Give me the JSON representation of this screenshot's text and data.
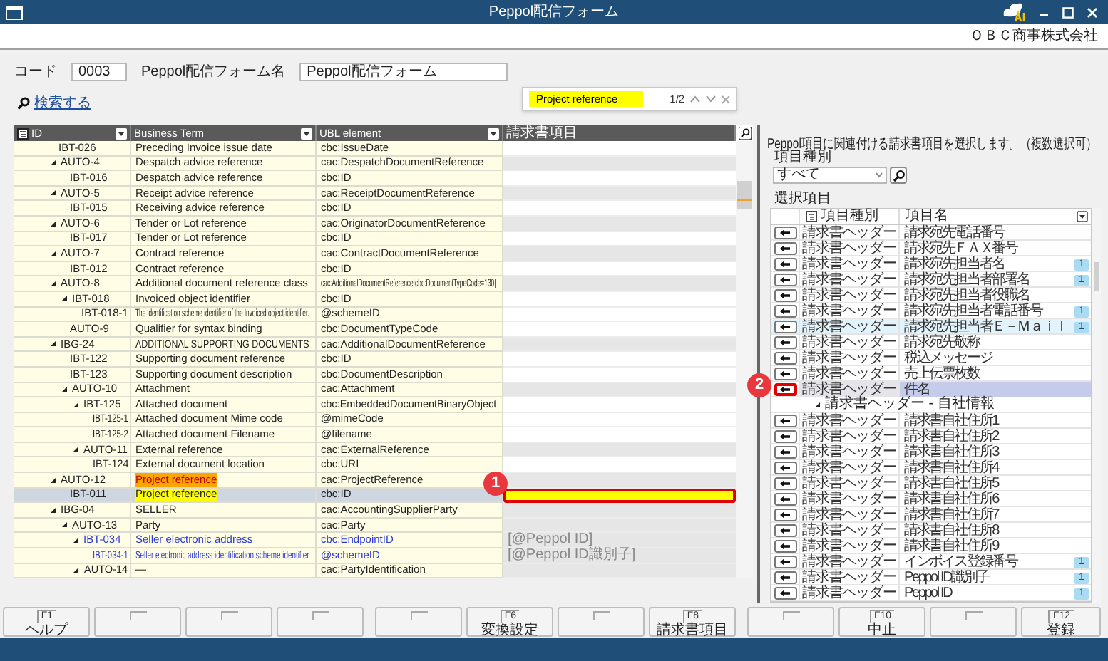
{
  "window": {
    "title": "Peppol配信フォーム",
    "company": "ＯＢＣ商事株式会社"
  },
  "header_fields": [
    {
      "label": "コード",
      "value": "0003"
    },
    {
      "label": "Peppol配信フォーム名",
      "value": "Peppol配信フォーム"
    }
  ],
  "search_link": "検索する",
  "find_bar": {
    "query": "Project reference",
    "count": "1/2"
  },
  "mapping_table": {
    "columns": [
      "ID",
      "Business Term",
      "UBL element",
      "請求書項目"
    ],
    "rows": [
      {
        "id": "IBT-026",
        "term": "Preceding Invoice issue date",
        "ubl": "cbc:IssueDate",
        "mappable": true,
        "fixed": false,
        "matched": false,
        "selected": false,
        "outlined": false
      },
      {
        "id": "AUTO-4",
        "term": "Despatch advice reference",
        "ubl": "cac:DespatchDocumentReference",
        "mappable": false,
        "fixed": false,
        "matched": false,
        "selected": false,
        "outlined": false,
        "expanded": true,
        "children": [
          {
            "id": "IBT-016",
            "term": "Despatch advice reference",
            "ubl": "cbc:ID",
            "mappable": true,
            "fixed": false,
            "matched": false,
            "selected": false,
            "outlined": false
          }
        ]
      },
      {
        "id": "AUTO-5",
        "term": "Receipt advice reference",
        "ubl": "cac:ReceiptDocumentReference",
        "mappable": false,
        "fixed": false,
        "matched": false,
        "selected": false,
        "outlined": false,
        "expanded": true,
        "children": [
          {
            "id": "IBT-015",
            "term": "Receiving advice reference",
            "ubl": "cbc:ID",
            "mappable": true,
            "fixed": false,
            "matched": false,
            "selected": false,
            "outlined": false
          }
        ]
      },
      {
        "id": "AUTO-6",
        "term": "Tender or Lot reference",
        "ubl": "cac:OriginatorDocumentReference",
        "mappable": false,
        "fixed": false,
        "matched": false,
        "selected": false,
        "outlined": false,
        "expanded": true,
        "children": [
          {
            "id": "IBT-017",
            "term": "Tender or Lot reference",
            "ubl": "cbc:ID",
            "mappable": true,
            "fixed": false,
            "matched": false,
            "selected": false,
            "outlined": false
          }
        ]
      },
      {
        "id": "AUTO-7",
        "term": "Contract reference",
        "ubl": "cac:ContractDocumentReference",
        "mappable": false,
        "fixed": false,
        "matched": false,
        "selected": false,
        "outlined": false,
        "expanded": true,
        "children": [
          {
            "id": "IBT-012",
            "term": "Contract reference",
            "ubl": "cbc:ID",
            "mappable": true,
            "fixed": false,
            "matched": false,
            "selected": false,
            "outlined": false
          }
        ]
      },
      {
        "id": "AUTO-8",
        "term": "Additional document reference class",
        "ubl": "cac:AdditionalDocumentReference[cbc:DocumentTypeCode=130]",
        "mappable": false,
        "fixed": false,
        "matched": false,
        "selected": false,
        "outlined": false,
        "expanded": true,
        "children": [
          {
            "id": "IBT-018",
            "term": "Invoiced object identifier",
            "ubl": "cbc:ID",
            "mappable": true,
            "fixed": false,
            "matched": false,
            "selected": false,
            "outlined": false,
            "expanded": true,
            "children": [
              {
                "id": "IBT-018-1",
                "term": "The identification scheme identifier of the Invoiced object identifier.",
                "ubl": "@schemeID",
                "mappable": true,
                "fixed": false,
                "matched": false,
                "selected": false,
                "outlined": false
              }
            ]
          },
          {
            "id": "AUTO-9",
            "term": "Qualifier for syntax binding",
            "ubl": "cbc:DocumentTypeCode",
            "mappable": true,
            "fixed": false,
            "matched": false,
            "selected": false,
            "outlined": false
          }
        ]
      },
      {
        "id": "IBG-24",
        "term": "ADDITIONAL SUPPORTING DOCUMENTS",
        "ubl": "cac:AdditionalDocumentReference",
        "mappable": false,
        "fixed": false,
        "matched": false,
        "selected": false,
        "outlined": false,
        "expanded": true,
        "children": [
          {
            "id": "IBT-122",
            "term": "Supporting document reference",
            "ubl": "cbc:ID",
            "mappable": true,
            "fixed": false,
            "matched": false,
            "selected": false,
            "outlined": false
          },
          {
            "id": "IBT-123",
            "term": "Supporting document description",
            "ubl": "cbc:DocumentDescription",
            "mappable": true,
            "fixed": false,
            "matched": false,
            "selected": false,
            "outlined": false
          },
          {
            "id": "AUTO-10",
            "term": "Attachment",
            "ubl": "cac:Attachment",
            "mappable": false,
            "fixed": false,
            "matched": false,
            "selected": false,
            "outlined": false,
            "expanded": true,
            "children": [
              {
                "id": "IBT-125",
                "term": "Attached document",
                "ubl": "cbc:EmbeddedDocumentBinaryObject",
                "mappable": true,
                "fixed": false,
                "matched": false,
                "selected": false,
                "outlined": false,
                "expanded": true,
                "children": [
                  {
                    "id": "IBT-125-1",
                    "term": "Attached document Mime code",
                    "ubl": "@mimeCode",
                    "mappable": true,
                    "fixed": false,
                    "matched": false,
                    "selected": false,
                    "outlined": false
                  },
                  {
                    "id": "IBT-125-2",
                    "term": "Attached document Filename",
                    "ubl": "@filename",
                    "mappable": true,
                    "fixed": false,
                    "matched": false,
                    "selected": false,
                    "outlined": false
                  }
                ]
              },
              {
                "id": "AUTO-11",
                "term": "External reference",
                "ubl": "cac:ExternalReference",
                "mappable": false,
                "fixed": false,
                "matched": false,
                "selected": false,
                "outlined": false,
                "expanded": true,
                "children": [
                  {
                    "id": "IBT-124",
                    "term": "External document location",
                    "ubl": "cbc:URI",
                    "mappable": true,
                    "fixed": false,
                    "matched": false,
                    "selected": false,
                    "outlined": false
                  }
                ]
              }
            ]
          }
        ]
      },
      {
        "id": "AUTO-12",
        "term": "Project reference",
        "ubl": "cac:ProjectReference",
        "mappable": false,
        "fixed": false,
        "matched": true,
        "current_match": true,
        "selected": false,
        "outlined": false,
        "expanded": true,
        "children": [
          {
            "id": "IBT-011",
            "term": "Project reference",
            "ubl": "cbc:ID",
            "mappable": true,
            "fixed": false,
            "matched": true,
            "current_match": false,
            "selected": true,
            "outlined": true
          }
        ]
      },
      {
        "id": "IBG-04",
        "term": "SELLER",
        "ubl": "cac:AccountingSupplierParty",
        "mappable": false,
        "fixed": false,
        "matched": false,
        "selected": false,
        "outlined": false,
        "expanded": true,
        "children": [
          {
            "id": "AUTO-13",
            "term": "Party",
            "ubl": "cac:Party",
            "mappable": false,
            "fixed": false,
            "matched": false,
            "selected": false,
            "outlined": false,
            "expanded": true,
            "children": [
              {
                "id": "IBT-034",
                "term": "Seller electronic address",
                "ubl": "cbc:EndpointID",
                "value": "[@Peppol ID]",
                "mappable": false,
                "fixed": true,
                "matched": false,
                "selected": false,
                "outlined": false,
                "expanded": true,
                "children": [
                  {
                    "id": "IBT-034-1",
                    "term": "Seller electronic address identification scheme identifier",
                    "ubl": "@schemeID",
                    "value": "[@Peppol ID識別子]",
                    "mappable": false,
                    "fixed": true,
                    "matched": false,
                    "selected": false,
                    "outlined": false
                  }
                ]
              },
              {
                "id": "AUTO-14",
                "term": "—",
                "ubl": "cac:PartyIdentification",
                "mappable": false,
                "fixed": false,
                "matched": false,
                "selected": false,
                "outlined": false,
                "expanded": true
              }
            ]
          }
        ]
      }
    ]
  },
  "right_panel": {
    "instruction": "Peppol項目に関連付ける請求書項目を選択します。（複数選択可）",
    "category_label": "項目種別",
    "category_value": "すべて",
    "list_label": "選択項目",
    "columns": [
      "項目種別",
      "項目名"
    ],
    "rows": [
      {
        "kind": "item",
        "type": "請求書ヘッダー",
        "name": "請求宛先電話番号",
        "selected": false,
        "hovered": false,
        "outlined": false
      },
      {
        "kind": "item",
        "type": "請求書ヘッダー",
        "name": "請求宛先ＦＡＸ番号",
        "selected": false,
        "hovered": false,
        "outlined": false
      },
      {
        "kind": "item",
        "type": "請求書ヘッダー",
        "name": "請求宛先担当者名",
        "badge": "1",
        "selected": false,
        "hovered": false,
        "outlined": false
      },
      {
        "kind": "item",
        "type": "請求書ヘッダー",
        "name": "請求宛先担当者部署名",
        "badge": "1",
        "selected": false,
        "hovered": false,
        "outlined": false
      },
      {
        "kind": "item",
        "type": "請求書ヘッダー",
        "name": "請求宛先担当者役職名",
        "selected": false,
        "hovered": false,
        "outlined": false
      },
      {
        "kind": "item",
        "type": "請求書ヘッダー",
        "name": "請求宛先担当者電話番号",
        "badge": "1",
        "selected": false,
        "hovered": false,
        "outlined": false
      },
      {
        "kind": "item",
        "type": "請求書ヘッダー",
        "name": "請求宛先担当者Ｅ－Ｍａｉｌ",
        "badge": "1",
        "selected": false,
        "hovered": true,
        "outlined": false
      },
      {
        "kind": "item",
        "type": "請求書ヘッダー",
        "name": "請求宛先敬称",
        "selected": false,
        "hovered": false,
        "outlined": false
      },
      {
        "kind": "item",
        "type": "請求書ヘッダー",
        "name": "税込メッセージ",
        "selected": false,
        "hovered": false,
        "outlined": false
      },
      {
        "kind": "item",
        "type": "請求書ヘッダー",
        "name": "売上伝票枚数",
        "selected": false,
        "hovered": false,
        "outlined": false
      },
      {
        "kind": "item",
        "type": "請求書ヘッダー",
        "name": "件名",
        "selected": true,
        "hovered": false,
        "outlined": true
      },
      {
        "kind": "group",
        "label": "請求書ヘッダー - 自社情報",
        "expanded": true,
        "children": [
          {
            "kind": "item",
            "type": "請求書ヘッダー",
            "name": "請求書自社住所1",
            "selected": false,
            "hovered": false,
            "outlined": false
          },
          {
            "kind": "item",
            "type": "請求書ヘッダー",
            "name": "請求書自社住所2",
            "selected": false,
            "hovered": false,
            "outlined": false
          },
          {
            "kind": "item",
            "type": "請求書ヘッダー",
            "name": "請求書自社住所3",
            "selected": false,
            "hovered": false,
            "outlined": false
          },
          {
            "kind": "item",
            "type": "請求書ヘッダー",
            "name": "請求書自社住所4",
            "selected": false,
            "hovered": false,
            "outlined": false
          },
          {
            "kind": "item",
            "type": "請求書ヘッダー",
            "name": "請求書自社住所5",
            "selected": false,
            "hovered": false,
            "outlined": false
          },
          {
            "kind": "item",
            "type": "請求書ヘッダー",
            "name": "請求書自社住所6",
            "selected": false,
            "hovered": false,
            "outlined": false
          },
          {
            "kind": "item",
            "type": "請求書ヘッダー",
            "name": "請求書自社住所7",
            "selected": false,
            "hovered": false,
            "outlined": false
          },
          {
            "kind": "item",
            "type": "請求書ヘッダー",
            "name": "請求書自社住所8",
            "selected": false,
            "hovered": false,
            "outlined": false
          },
          {
            "kind": "item",
            "type": "請求書ヘッダー",
            "name": "請求書自社住所9",
            "selected": false,
            "hovered": false,
            "outlined": false
          },
          {
            "kind": "item",
            "type": "請求書ヘッダー",
            "name": "インボイス登録番号",
            "badge": "1",
            "selected": false,
            "hovered": false,
            "outlined": false
          },
          {
            "kind": "item",
            "type": "請求書ヘッダー",
            "name": "Peppol ID識別子",
            "badge": "1",
            "selected": false,
            "hovered": false,
            "outlined": false
          },
          {
            "kind": "item",
            "type": "請求書ヘッダー",
            "name": "Peppol ID",
            "badge": "1",
            "selected": false,
            "hovered": false,
            "outlined": false
          }
        ]
      }
    ]
  },
  "function_keys": [
    {
      "kind": "key",
      "key": "F1",
      "label": "ヘルプ"
    },
    {
      "kind": "blank"
    },
    {
      "kind": "blank"
    },
    {
      "kind": "blank"
    },
    {
      "kind": "blank"
    },
    {
      "kind": "key",
      "key": "F6",
      "label": "変換設定"
    },
    {
      "kind": "blank"
    },
    {
      "kind": "key",
      "key": "F8",
      "label": "請求書項目"
    },
    {
      "kind": "blank"
    },
    {
      "kind": "key",
      "key": "F10",
      "label": "中止"
    },
    {
      "kind": "blank"
    },
    {
      "kind": "key",
      "key": "F12",
      "label": "登録"
    }
  ],
  "callouts": [
    {
      "label": "1"
    },
    {
      "label": "2"
    }
  ]
}
